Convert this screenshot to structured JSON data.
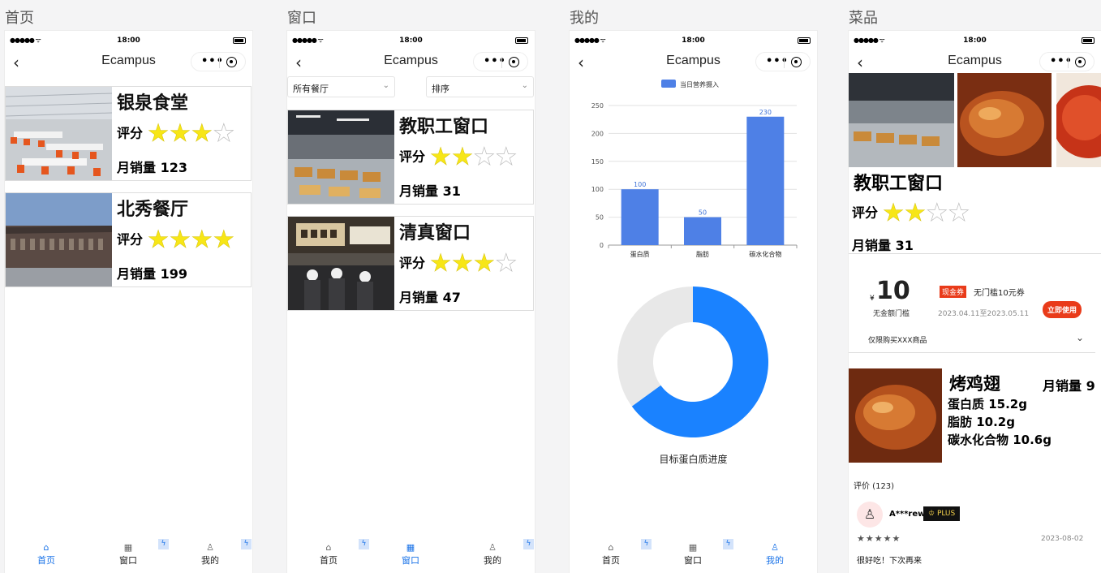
{
  "labels": [
    "首页",
    "窗口",
    "我的",
    "菜品"
  ],
  "status_time": "18:00",
  "signal": "●●●●● ᯤ",
  "app_title": "Ecampus",
  "back_icon": "chevron-left-icon",
  "rating_label": "评分",
  "sales_label": "月销量",
  "home": {
    "cards": [
      {
        "name": "银泉食堂",
        "stars": 3,
        "sales": "123"
      },
      {
        "name": "北秀餐厅",
        "stars": 4,
        "sales": "199"
      }
    ]
  },
  "window": {
    "filter": "所有餐厅",
    "sort": "排序",
    "cards": [
      {
        "name": "教职工窗口",
        "stars": 2,
        "sales": "31"
      },
      {
        "name": "清真窗口",
        "stars": 3,
        "sales": "47"
      }
    ]
  },
  "mine": {
    "donut_label": "目标蛋白质进度"
  },
  "chart_data": [
    {
      "type": "bar",
      "categories": [
        "蛋白质",
        "脂肪",
        "碳水化合物"
      ],
      "values": [
        100,
        50,
        230
      ],
      "series": [
        {
          "name": "当日营养摄入",
          "values": [
            100,
            50,
            230
          ]
        }
      ],
      "ylim": [
        0,
        250
      ],
      "yticks": [
        0,
        50,
        100,
        150,
        200,
        250
      ],
      "color": "#4e80e6",
      "legend": "top-center",
      "grid": true
    },
    {
      "type": "pie",
      "subtype": "donut",
      "values": [
        65,
        35
      ],
      "colors": [
        "#1a82ff",
        "#e8e8e8"
      ],
      "title": "目标蛋白质进度"
    }
  ],
  "dish": {
    "window_name": "教职工窗口",
    "stars": 2,
    "sales": "31",
    "coupon": {
      "currency": "¥",
      "amount": "10",
      "threshold": "无金额门槛",
      "tag": "现金券",
      "desc": "无门槛10元券",
      "validity": "2023.04.11至2023.05.11",
      "button": "立即使用",
      "scope": "仅限购买XXX商品"
    },
    "item": {
      "name": "烤鸡翅",
      "sales": "月销量 9",
      "protein": "蛋白质 15.2g",
      "fat": "脂肪 10.2g",
      "carbs": "碳水化合物 10.6g"
    },
    "reviews_header": "评价 (123)",
    "review": {
      "user": "A***rew",
      "badge": "PLUS",
      "stars": "★★★★★",
      "date": "2023-08-02",
      "text": "很好吃！下次再来"
    }
  },
  "tabs": [
    "首页",
    "窗口",
    "我的"
  ],
  "colors": {
    "accent": "#1a73e8",
    "star": "#f7e617",
    "coupon_red": "#e93b1a"
  }
}
